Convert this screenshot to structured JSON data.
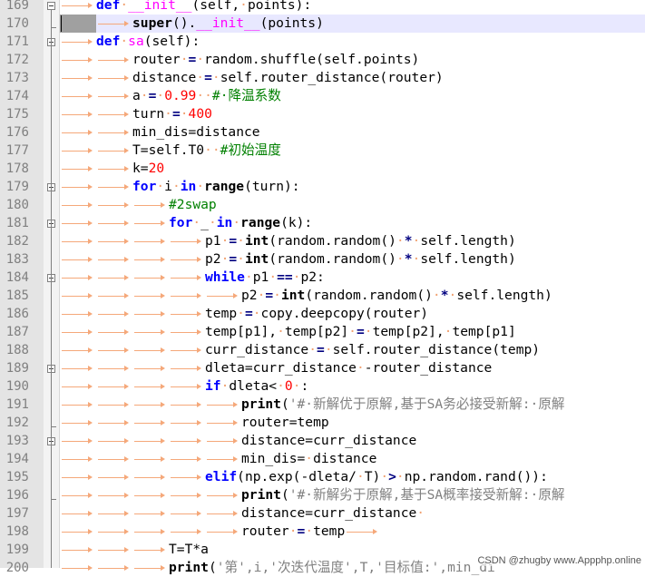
{
  "editor": {
    "lines": [
      {
        "n": "169",
        "indent": 1,
        "tokens": [
          [
            "kw",
            "def"
          ],
          [
            "sp",
            "·"
          ],
          [
            "fn",
            "__init__"
          ],
          [
            "t",
            "(self,"
          ],
          [
            "sp",
            "·"
          ],
          [
            "t",
            "points):"
          ]
        ]
      },
      {
        "n": "170",
        "indent": 2,
        "tokens": [
          [
            "sf",
            "super"
          ],
          [
            "t",
            "()."
          ],
          [
            "fn",
            "__init__"
          ],
          [
            "t",
            "(points)"
          ]
        ]
      },
      {
        "n": "171",
        "indent": 1,
        "tokens": [
          [
            "kw",
            "def"
          ],
          [
            "sp",
            "·"
          ],
          [
            "fn",
            "sa"
          ],
          [
            "t",
            "(self):"
          ]
        ]
      },
      {
        "n": "172",
        "indent": 2,
        "tokens": [
          [
            "t",
            "router"
          ],
          [
            "sp",
            "·"
          ],
          [
            "op",
            "="
          ],
          [
            "sp",
            "·"
          ],
          [
            "t",
            "random.shuffle(self.points)"
          ]
        ]
      },
      {
        "n": "173",
        "indent": 2,
        "tokens": [
          [
            "t",
            "distance"
          ],
          [
            "sp",
            "·"
          ],
          [
            "op",
            "="
          ],
          [
            "sp",
            "·"
          ],
          [
            "t",
            "self.router_distance(router)"
          ]
        ]
      },
      {
        "n": "174",
        "indent": 2,
        "tokens": [
          [
            "t",
            "a"
          ],
          [
            "sp",
            "·"
          ],
          [
            "op",
            "="
          ],
          [
            "sp",
            "·"
          ],
          [
            "num",
            "0.99"
          ],
          [
            "sp",
            "··"
          ],
          [
            "cm",
            "#·降温系数"
          ]
        ]
      },
      {
        "n": "175",
        "indent": 2,
        "tokens": [
          [
            "t",
            "turn"
          ],
          [
            "sp",
            "·"
          ],
          [
            "op",
            "="
          ],
          [
            "sp",
            "·"
          ],
          [
            "num",
            "400"
          ]
        ]
      },
      {
        "n": "176",
        "indent": 2,
        "tokens": [
          [
            "t",
            "min_dis=distance"
          ]
        ]
      },
      {
        "n": "177",
        "indent": 2,
        "tokens": [
          [
            "t",
            "T=self.T0"
          ],
          [
            "sp",
            "··"
          ],
          [
            "cm",
            "#初始温度"
          ]
        ]
      },
      {
        "n": "178",
        "indent": 2,
        "tokens": [
          [
            "t",
            "k="
          ],
          [
            "num",
            "20"
          ]
        ]
      },
      {
        "n": "179",
        "indent": 2,
        "tokens": [
          [
            "kw",
            "for"
          ],
          [
            "sp",
            "·"
          ],
          [
            "t",
            "i"
          ],
          [
            "sp",
            "·"
          ],
          [
            "kw",
            "in"
          ],
          [
            "sp",
            "·"
          ],
          [
            "sf",
            "range"
          ],
          [
            "t",
            "(turn):"
          ]
        ]
      },
      {
        "n": "180",
        "indent": 3,
        "tokens": [
          [
            "cm",
            "#2swap"
          ]
        ]
      },
      {
        "n": "181",
        "indent": 3,
        "tokens": [
          [
            "kw",
            "for"
          ],
          [
            "sp",
            "·"
          ],
          [
            "t",
            "_"
          ],
          [
            "sp",
            "·"
          ],
          [
            "kw",
            "in"
          ],
          [
            "sp",
            "·"
          ],
          [
            "sf",
            "range"
          ],
          [
            "t",
            "(k):"
          ]
        ]
      },
      {
        "n": "182",
        "indent": 4,
        "tokens": [
          [
            "t",
            "p1"
          ],
          [
            "sp",
            "·"
          ],
          [
            "op",
            "="
          ],
          [
            "sp",
            "·"
          ],
          [
            "sf",
            "int"
          ],
          [
            "t",
            "(random.random()"
          ],
          [
            "sp",
            "·"
          ],
          [
            "op",
            "*"
          ],
          [
            "sp",
            "·"
          ],
          [
            "t",
            "self.length)"
          ]
        ]
      },
      {
        "n": "183",
        "indent": 4,
        "tokens": [
          [
            "t",
            "p2"
          ],
          [
            "sp",
            "·"
          ],
          [
            "op",
            "="
          ],
          [
            "sp",
            "·"
          ],
          [
            "sf",
            "int"
          ],
          [
            "t",
            "(random.random()"
          ],
          [
            "sp",
            "·"
          ],
          [
            "op",
            "*"
          ],
          [
            "sp",
            "·"
          ],
          [
            "t",
            "self.length)"
          ]
        ]
      },
      {
        "n": "184",
        "indent": 4,
        "tokens": [
          [
            "kw",
            "while"
          ],
          [
            "sp",
            "·"
          ],
          [
            "t",
            "p1"
          ],
          [
            "sp",
            "·"
          ],
          [
            "op",
            "=="
          ],
          [
            "sp",
            "·"
          ],
          [
            "t",
            "p2:"
          ]
        ]
      },
      {
        "n": "185",
        "indent": 5,
        "tokens": [
          [
            "t",
            "p2"
          ],
          [
            "sp",
            "·"
          ],
          [
            "op",
            "="
          ],
          [
            "sp",
            "·"
          ],
          [
            "sf",
            "int"
          ],
          [
            "t",
            "(random.random()"
          ],
          [
            "sp",
            "·"
          ],
          [
            "op",
            "*"
          ],
          [
            "sp",
            "·"
          ],
          [
            "t",
            "self.length)"
          ]
        ]
      },
      {
        "n": "186",
        "indent": 4,
        "tokens": [
          [
            "t",
            "temp"
          ],
          [
            "sp",
            "·"
          ],
          [
            "op",
            "="
          ],
          [
            "sp",
            "·"
          ],
          [
            "t",
            "copy.deepcopy(router)"
          ]
        ]
      },
      {
        "n": "187",
        "indent": 4,
        "tokens": [
          [
            "t",
            "temp[p1],"
          ],
          [
            "sp",
            "·"
          ],
          [
            "t",
            "temp[p2]"
          ],
          [
            "sp",
            "·"
          ],
          [
            "op",
            "="
          ],
          [
            "sp",
            "·"
          ],
          [
            "t",
            "temp[p2],"
          ],
          [
            "sp",
            "·"
          ],
          [
            "t",
            "temp[p1]"
          ]
        ]
      },
      {
        "n": "188",
        "indent": 4,
        "tokens": [
          [
            "t",
            "curr_distance"
          ],
          [
            "sp",
            "·"
          ],
          [
            "op",
            "="
          ],
          [
            "sp",
            "·"
          ],
          [
            "t",
            "self.router_distance(temp)"
          ]
        ]
      },
      {
        "n": "189",
        "indent": 4,
        "tokens": [
          [
            "t",
            "dleta=curr_distance"
          ],
          [
            "sp",
            "·"
          ],
          [
            "t",
            "-router_distance"
          ]
        ]
      },
      {
        "n": "190",
        "indent": 4,
        "tokens": [
          [
            "kw",
            "if"
          ],
          [
            "sp",
            "·"
          ],
          [
            "t",
            "dleta<"
          ],
          [
            "sp",
            "·"
          ],
          [
            "num",
            "0"
          ],
          [
            "sp",
            "·"
          ],
          [
            "t",
            ":"
          ]
        ]
      },
      {
        "n": "191",
        "indent": 5,
        "tokens": [
          [
            "sf",
            "print"
          ],
          [
            "t",
            "("
          ],
          [
            "str",
            "'#·新解优于原解,基于SA务必接受新解:·原解"
          ]
        ]
      },
      {
        "n": "192",
        "indent": 5,
        "tokens": [
          [
            "t",
            "router=temp"
          ]
        ]
      },
      {
        "n": "193",
        "indent": 5,
        "tokens": [
          [
            "t",
            "distance=curr_distance"
          ]
        ]
      },
      {
        "n": "194",
        "indent": 5,
        "tokens": [
          [
            "t",
            "min_dis="
          ],
          [
            "sp",
            "·"
          ],
          [
            "t",
            "distance"
          ]
        ]
      },
      {
        "n": "195",
        "indent": 4,
        "tokens": [
          [
            "kw",
            "elif"
          ],
          [
            "t",
            "(np.exp(-dleta/"
          ],
          [
            "sp",
            "·"
          ],
          [
            "t",
            "T)"
          ],
          [
            "sp",
            "·"
          ],
          [
            "op",
            ">"
          ],
          [
            "sp",
            "·"
          ],
          [
            "t",
            "np.random.rand()):"
          ]
        ]
      },
      {
        "n": "196",
        "indent": 5,
        "tokens": [
          [
            "sf",
            "print"
          ],
          [
            "t",
            "("
          ],
          [
            "str",
            "'#·新解劣于原解,基于SA概率接受新解:·原解"
          ]
        ]
      },
      {
        "n": "197",
        "indent": 5,
        "tokens": [
          [
            "t",
            "distance=curr_distance"
          ],
          [
            "sp",
            "·"
          ]
        ]
      },
      {
        "n": "198",
        "indent": 5,
        "tokens": [
          [
            "t",
            "router"
          ],
          [
            "sp",
            "·"
          ],
          [
            "op",
            "="
          ],
          [
            "sp",
            "·"
          ],
          [
            "t",
            "temp"
          ],
          [
            "arrow",
            ""
          ]
        ]
      },
      {
        "n": "199",
        "indent": 3,
        "tokens": [
          [
            "t",
            "T=T*a"
          ]
        ]
      },
      {
        "n": "200",
        "indent": 3,
        "tokens": [
          [
            "sf",
            "print"
          ],
          [
            "t",
            "("
          ],
          [
            "str",
            "'第',i,'次迭代温度',T,'目标值:',min_di"
          ]
        ]
      }
    ],
    "folds": [
      0,
      2,
      10,
      12,
      15,
      20,
      24
    ]
  },
  "watermark": "CSDN @zhugby www.Appphp.online"
}
